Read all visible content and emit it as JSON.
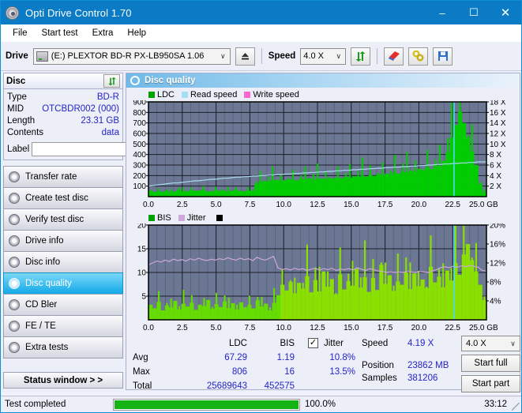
{
  "window": {
    "title": "Opti Drive Control 1.70",
    "icon": "disc-icon",
    "minimize": "–",
    "maximize": "☐",
    "close": "✕"
  },
  "menu": {
    "items": [
      "File",
      "Start test",
      "Extra",
      "Help"
    ]
  },
  "toolbar": {
    "drive_label": "Drive",
    "drive_value": "(E:)   PLEXTOR BD-R  PX-LB950SA 1.06",
    "eject_icon": "eject-icon",
    "speed_label": "Speed",
    "speed_value": "4.0 X",
    "refresh_icon": "refresh-icon",
    "erase_icon": "eraser-icon",
    "tools_icon": "tools-icon",
    "save_icon": "save-icon",
    "dropdown_arrow": "∨"
  },
  "disc": {
    "header": "Disc",
    "refresh_icon": "refresh-icon",
    "rows": [
      {
        "key": "Type",
        "value": "BD-R"
      },
      {
        "key": "MID",
        "value": "OTCBDR002 (000)"
      },
      {
        "key": "Length",
        "value": "23.31 GB"
      },
      {
        "key": "Contents",
        "value": "data"
      }
    ],
    "label_key": "Label",
    "label_value": "",
    "label_placeholder": "",
    "disc_icon": "cd-icon"
  },
  "sidebar": {
    "items": [
      {
        "label": "Transfer rate",
        "icon": "disc-icon",
        "active": false
      },
      {
        "label": "Create test disc",
        "icon": "disc-icon",
        "active": false
      },
      {
        "label": "Verify test disc",
        "icon": "disc-icon",
        "active": false
      },
      {
        "label": "Drive info",
        "icon": "disc-icon",
        "active": false
      },
      {
        "label": "Disc info",
        "icon": "disc-icon",
        "active": false
      },
      {
        "label": "Disc quality",
        "icon": "disc-icon",
        "active": true
      },
      {
        "label": "CD Bler",
        "icon": "disc-icon",
        "active": false
      },
      {
        "label": "FE / TE",
        "icon": "disc-icon",
        "active": false
      },
      {
        "label": "Extra tests",
        "icon": "disc-icon",
        "active": false
      }
    ],
    "status_window": "Status window > >"
  },
  "panel": {
    "title": "Disc quality",
    "icon": "disc-icon"
  },
  "chart_data": [
    {
      "type": "line",
      "title": "LDC / Read speed",
      "xlabel": "GB",
      "ylabel": "LDC",
      "legend": [
        {
          "label": "LDC",
          "color": "#00a000"
        },
        {
          "label": "Read speed",
          "color": "#a8dcf0"
        },
        {
          "label": "Write speed",
          "color": "#ff66cc"
        }
      ],
      "legend_position": "top-left",
      "grid": true,
      "x": [
        0.0,
        2.5,
        5.0,
        7.5,
        10.0,
        12.5,
        15.0,
        17.5,
        20.0,
        22.5,
        25.0
      ],
      "xlim": [
        0.0,
        25.0
      ],
      "xticks": [
        "0.0",
        "2.5",
        "5.0",
        "7.5",
        "10.0",
        "12.5",
        "15.0",
        "17.5",
        "20.0",
        "22.5",
        "25.0"
      ],
      "xunit": "GB",
      "ylim": [
        0,
        900
      ],
      "yticks": [
        "100",
        "200",
        "300",
        "400",
        "500",
        "600",
        "700",
        "800",
        "900"
      ],
      "y2lim": [
        0,
        18
      ],
      "y2ticks": [
        "2 X",
        "4 X",
        "6 X",
        "8 X",
        "10 X",
        "12 X",
        "14 X",
        "16 X",
        "18 X"
      ],
      "series": [
        {
          "name": "LDC",
          "color": "#00cc00",
          "values": [
            60,
            45,
            50,
            48,
            55,
            42,
            50,
            65,
            48,
            52,
            60,
            55,
            58,
            62,
            50,
            48,
            55,
            60,
            52,
            48,
            58,
            62,
            55,
            50,
            58,
            60,
            120,
            140,
            150,
            145,
            155,
            160,
            150,
            158,
            165,
            160,
            155,
            170,
            165,
            175,
            160,
            168,
            172,
            165,
            178,
            170,
            182,
            175,
            188,
            180,
            195,
            185,
            200,
            190,
            205,
            198,
            215,
            205,
            220,
            210,
            230,
            218,
            240,
            228,
            250,
            238,
            265,
            250,
            280,
            262,
            300,
            285,
            340,
            420,
            560,
            680,
            806,
            700,
            560,
            430,
            300,
            120,
            40
          ]
        },
        {
          "name": "Read speed",
          "color": "#a8dcf0",
          "values": [
            2.0,
            2.1,
            2.2,
            2.3,
            2.4,
            2.5,
            2.6,
            2.6,
            2.7,
            2.8,
            2.9,
            3.0,
            3.0,
            3.1,
            3.2,
            3.3,
            3.3,
            3.4,
            3.5,
            3.5,
            3.6,
            3.7,
            3.7,
            3.8,
            3.8,
            3.9,
            3.9,
            4.0,
            4.0,
            4.1,
            4.1,
            4.2,
            4.2,
            4.3,
            4.3,
            4.4,
            4.4,
            4.5,
            4.5,
            4.6,
            4.6,
            4.7,
            4.7,
            4.8,
            4.8,
            4.9,
            4.9,
            5.0,
            5.0,
            5.1,
            5.1,
            5.2,
            5.2,
            5.3,
            5.3,
            5.4,
            5.4,
            5.5,
            5.5,
            5.6,
            5.6,
            5.7,
            5.7,
            5.8,
            5.8,
            5.9,
            5.9,
            6.0,
            6.0,
            6.1,
            6.1,
            6.2,
            6.2,
            6.3,
            6.3,
            6.4,
            6.4,
            6.5,
            6.5,
            6.6,
            6.6,
            6.6
          ]
        }
      ],
      "cursor_x": 22.6
    },
    {
      "type": "bar",
      "title": "BIS / Jitter",
      "xlabel": "GB",
      "ylabel": "BIS",
      "legend": [
        {
          "label": "BIS",
          "color": "#00a000"
        },
        {
          "label": "Jitter",
          "color": "#c8a8d8"
        }
      ],
      "legend_position": "top-left",
      "grid": true,
      "xlim": [
        0.0,
        25.0
      ],
      "xticks": [
        "0.0",
        "2.5",
        "5.0",
        "7.5",
        "10.0",
        "12.5",
        "15.0",
        "17.5",
        "20.0",
        "22.5",
        "25.0"
      ],
      "xunit": "GB",
      "ylim": [
        0,
        20
      ],
      "yticks": [
        "5",
        "10",
        "15",
        "20"
      ],
      "y2lim": [
        0,
        20
      ],
      "y2ticks": [
        "4%",
        "8%",
        "12%",
        "16%",
        "20%"
      ],
      "series": [
        {
          "name": "BIS",
          "color": "#66dd00",
          "values": [
            3.2,
            2.4,
            3.8,
            2.0,
            3.0,
            2.6,
            4.0,
            2.2,
            3.4,
            2.8,
            3.6,
            2.1,
            3.1,
            2.9,
            4.2,
            2.3,
            3.3,
            2.7,
            3.9,
            2.5,
            3.5,
            2.2,
            3.7,
            2.6,
            3.2,
            2.4,
            4.1,
            2.8,
            3.4,
            2.0,
            3.6,
            5.2,
            7.4,
            6.2,
            8.0,
            5.6,
            7.8,
            6.6,
            9.2,
            5.8,
            8.4,
            6.0,
            10.2,
            7.0,
            8.6,
            5.4,
            9.6,
            6.4,
            8.2,
            7.2,
            10.8,
            6.8,
            9.0,
            5.9,
            8.8,
            6.3,
            11.6,
            7.6,
            9.4,
            6.1,
            8.1,
            7.4,
            10.0,
            6.5,
            9.8,
            7.1,
            8.5,
            6.7,
            11.2,
            7.9,
            9.1,
            6.9,
            10.4,
            8.3,
            12.0,
            9.5,
            13.8,
            16.0,
            12.6,
            10.2,
            7.4,
            4.2
          ]
        },
        {
          "name": "Jitter",
          "color": "#cda8d8",
          "values": [
            11.6,
            12.0,
            12.4,
            12.2,
            12.6,
            12.3,
            12.8,
            12.5,
            12.7,
            12.4,
            12.9,
            12.6,
            13.0,
            12.7,
            12.5,
            12.8,
            12.6,
            12.9,
            12.7,
            13.1,
            12.8,
            12.6,
            13.0,
            12.7,
            12.9,
            12.5,
            13.2,
            12.8,
            12.6,
            13.0,
            13.4,
            11.0,
            10.6,
            10.8,
            10.5,
            10.9,
            10.6,
            10.8,
            10.4,
            10.7,
            10.9,
            10.5,
            10.8,
            10.6,
            10.9,
            10.4,
            10.7,
            10.6,
            10.8,
            10.5,
            11.0,
            10.7,
            10.4,
            10.8,
            10.6,
            10.3,
            10.2,
            10.0,
            10.1,
            10.0,
            10.1,
            10.0,
            10.2,
            10.1,
            10.0,
            10.2,
            10.1,
            10.0,
            10.3,
            10.6,
            11.0,
            11.2,
            11.0,
            11.3,
            11.1,
            11.4,
            11.2,
            11.5,
            11.3,
            11.1,
            10.4,
            10.3
          ]
        }
      ],
      "cursor_x": 22.6
    }
  ],
  "stats": {
    "columns": [
      "LDC",
      "BIS"
    ],
    "jitter_label": "Jitter",
    "jitter_checked": true,
    "rows": [
      {
        "label": "Avg",
        "ldc": "67.29",
        "bis": "1.19",
        "jitter": "10.8%"
      },
      {
        "label": "Max",
        "ldc": "806",
        "bis": "16",
        "jitter": "13.5%"
      },
      {
        "label": "Total",
        "ldc": "25689643",
        "bis": "452575",
        "jitter": ""
      }
    ]
  },
  "test_info": {
    "speed_label": "Speed",
    "speed_value": "4.19 X",
    "position_label": "Position",
    "position_value": "23862 MB",
    "samples_label": "Samples",
    "samples_value": "381206",
    "speed_select": "4.0 X",
    "dropdown_arrow": "∨",
    "start_full": "Start full",
    "start_part": "Start part"
  },
  "statusbar": {
    "text": "Test completed",
    "percent": "100.0%",
    "progress": 100,
    "time": "33:12"
  },
  "colors": {
    "accent": "#0a7bc4",
    "ldc": "#00cc00",
    "bis": "#66dd00",
    "read_speed": "#a8dcf0",
    "write_speed": "#ff66cc",
    "jitter": "#cda8d8",
    "plot_bg": "#6b7793",
    "value_text": "#2323c8",
    "progress": "#14b414"
  }
}
